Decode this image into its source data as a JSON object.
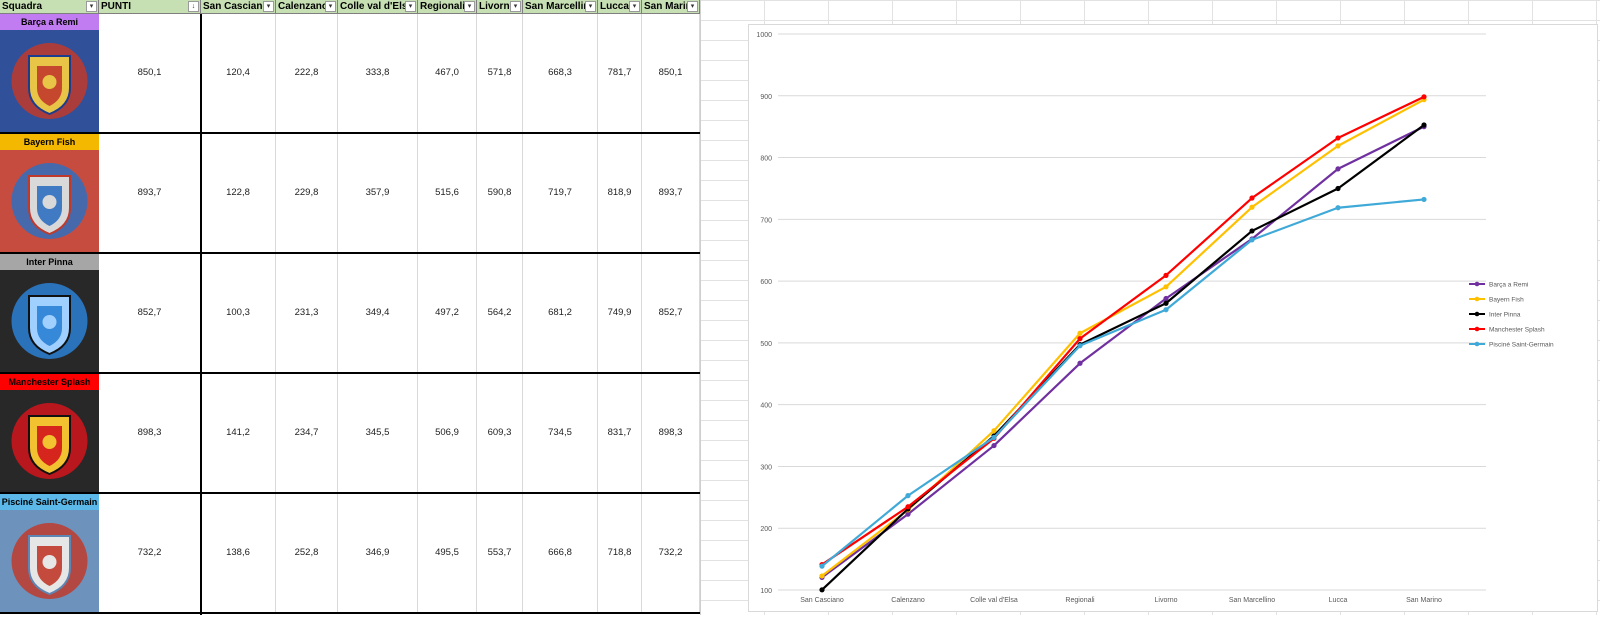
{
  "table": {
    "headers": [
      "Squadra",
      "PUNTI",
      "San Casciano",
      "Calenzano",
      "Colle val d'Elsa",
      "Regionali",
      "Livorno",
      "San Marcellino",
      "Lucca",
      "San Marino"
    ],
    "sort_indicator": "↓",
    "dropdown_glyph": "▾",
    "rows": [
      {
        "team": "Barça a Remi",
        "team_bg": "#c07cf0",
        "logo_colors": [
          "#1a3d8f",
          "#c0392b",
          "#e8c547"
        ],
        "punti": "850,1",
        "values": [
          "120,4",
          "222,8",
          "333,8",
          "467,0",
          "571,8",
          "668,3",
          "781,7",
          "850,1"
        ]
      },
      {
        "team": "Bayern Fish",
        "team_bg": "#f5b800",
        "logo_colors": [
          "#c0392b",
          "#2f6fbf",
          "#d9d9d9"
        ],
        "punti": "893,7",
        "values": [
          "122,8",
          "229,8",
          "357,9",
          "515,6",
          "590,8",
          "719,7",
          "818,9",
          "893,7"
        ]
      },
      {
        "team": "Inter Pinna",
        "team_bg": "#a6a6a6",
        "logo_colors": [
          "#111111",
          "#2a7fd4",
          "#9fd0ff"
        ],
        "punti": "852,7",
        "values": [
          "100,3",
          "231,3",
          "349,4",
          "497,2",
          "564,2",
          "681,2",
          "749,9",
          "852,7"
        ]
      },
      {
        "team": "Manchester Splash",
        "team_bg": "#ff0000",
        "logo_colors": [
          "#111111",
          "#d1141b",
          "#f2c230"
        ],
        "punti": "898,3",
        "values": [
          "141,2",
          "234,7",
          "345,5",
          "506,9",
          "609,3",
          "734,5",
          "831,7",
          "898,3"
        ]
      },
      {
        "team": "Pisciné Saint-Germain",
        "team_bg": "#5bb8e8",
        "logo_colors": [
          "#5d86b5",
          "#c0392b",
          "#e6e6e6"
        ],
        "punti": "732,2",
        "values": [
          "138,6",
          "252,8",
          "346,9",
          "495,5",
          "553,7",
          "666,8",
          "718,8",
          "732,2"
        ]
      }
    ]
  },
  "chart_data": {
    "type": "line",
    "title": "",
    "xlabel": "",
    "ylabel": "",
    "categories": [
      "San Casciano",
      "Calenzano",
      "Colle val d'Elsa",
      "Regionali",
      "Livorno",
      "San Marcellino",
      "Lucca",
      "San Marino"
    ],
    "ylim": [
      100,
      1000
    ],
    "yticks": [
      100,
      200,
      300,
      400,
      500,
      600,
      700,
      800,
      900,
      1000
    ],
    "grid": true,
    "legend_position": "right",
    "series": [
      {
        "name": "Barça a Remi",
        "color": "#7030a0",
        "values": [
          120.4,
          222.8,
          333.8,
          467.0,
          571.8,
          668.3,
          781.7,
          850.1
        ]
      },
      {
        "name": "Bayern Fish",
        "color": "#ffc000",
        "values": [
          122.8,
          229.8,
          357.9,
          515.6,
          590.8,
          719.7,
          818.9,
          893.7
        ]
      },
      {
        "name": "Inter Pinna",
        "color": "#000000",
        "values": [
          100.3,
          231.3,
          349.4,
          497.2,
          564.2,
          681.2,
          749.9,
          852.7
        ]
      },
      {
        "name": "Manchester Splash",
        "color": "#ff0000",
        "values": [
          141.2,
          234.7,
          345.5,
          506.9,
          609.3,
          734.5,
          831.7,
          898.3
        ]
      },
      {
        "name": "Pisciné Saint-Germain",
        "color": "#3fa9d8",
        "values": [
          138.6,
          252.8,
          346.9,
          495.5,
          553.7,
          666.8,
          718.8,
          732.2
        ]
      }
    ]
  }
}
